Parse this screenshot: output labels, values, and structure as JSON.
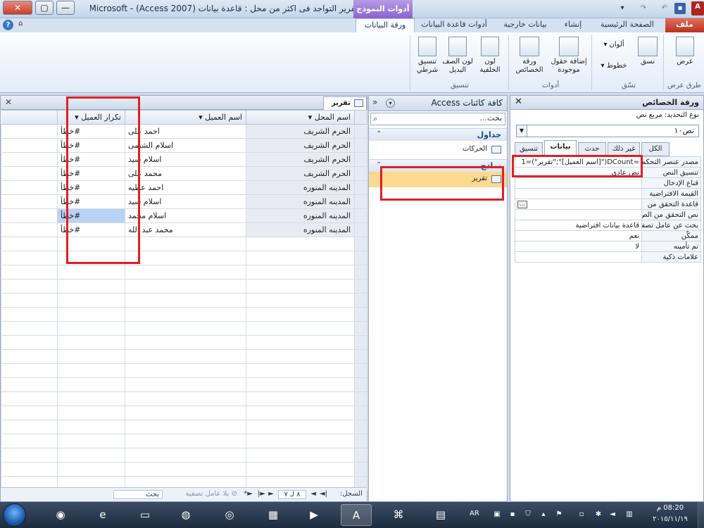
{
  "window": {
    "title": "تقرير التواجد فى اكثر من محل : قاعدة بيانات (Access 2007) - Microsoft ...",
    "context_group": "أدوات النموذج",
    "controls": {
      "close": "✕",
      "maximize": "▢",
      "minimize": "—"
    }
  },
  "ribbon_tabs": [
    {
      "label": "ملف"
    },
    {
      "label": "الصفحة الرئيسية"
    },
    {
      "label": "إنشاء"
    },
    {
      "label": "بيانات خارجية"
    },
    {
      "label": "أدوات قاعدة البيانات"
    },
    {
      "label": "ورقة البيانات"
    }
  ],
  "ribbon": {
    "view": {
      "label": "عرض",
      "group": "طرق عرض"
    },
    "format_group": {
      "label": "نسّق",
      "format_painter": "نسق",
      "font": "خطوط",
      "colors": "ألوان"
    },
    "tools_group": {
      "label": "أدوات",
      "add_fields": "إضافة حقول موجودة",
      "property_sheet": "ورقة الخصائص"
    },
    "formatting_group": {
      "label": "تنسيق",
      "background": "لون الخلفية",
      "alt_row": "لون الصف البديل",
      "conditional": "تنسيق شرطي"
    }
  },
  "datasheet": {
    "tab_label": "تقرير",
    "columns": [
      "اسم المحل",
      "اسم العميل",
      "تكرار العميل"
    ],
    "rows": [
      {
        "store": "الحرم الشريف",
        "customer": "احمد على",
        "repeat": "#خطأ"
      },
      {
        "store": "الحرم الشريف",
        "customer": "اسلام الشيمى",
        "repeat": "#خطأ"
      },
      {
        "store": "الحرم الشريف",
        "customer": "اسلام سيد",
        "repeat": "#خطأ"
      },
      {
        "store": "الحرم الشريف",
        "customer": "محمد على",
        "repeat": "#خطأ"
      },
      {
        "store": "المدينه المنوره",
        "customer": "احمد عطيه",
        "repeat": "#خطأ"
      },
      {
        "store": "المدينه المنوره",
        "customer": "اسلام سيد",
        "repeat": "#خطأ"
      },
      {
        "store": "المدينه المنوره",
        "customer": "اسلام محمد",
        "repeat": "#خطأ"
      },
      {
        "store": "المدينه المنوره",
        "customer": "محمد عبد الله",
        "repeat": "#خطأ"
      }
    ],
    "nav": {
      "record_label": "السجل:",
      "record_pos": "٨ لـ ٧",
      "no_filter": "بلا عامل تصفية",
      "search": "بحث"
    }
  },
  "nav_pane": {
    "title": "كافة كائنات Access",
    "search_placeholder": "بحث...",
    "groups": [
      {
        "label": "جداول",
        "items": [
          "الحركات"
        ]
      },
      {
        "label": "نماذج",
        "items": [
          "تقرير"
        ]
      }
    ]
  },
  "property_sheet": {
    "title": "ورقة الخصائص",
    "selection_type": "نوع التحديد: مربع نص",
    "control": "نص١٠",
    "tabs": [
      "الكل",
      "غير ذلك",
      "حدث",
      "بيانات",
      "تنسيق"
    ],
    "active_tab": "بيانات",
    "rows": [
      {
        "name": "مصدر عنصر التحكم",
        "value": "=DCount(\"[اسم العميل]\";\"تقرير\")=1"
      },
      {
        "name": "تنسيق النص",
        "value": "نص عادي"
      },
      {
        "name": "قناع الإدخال",
        "value": ""
      },
      {
        "name": "القيمة الافتراضية",
        "value": ""
      },
      {
        "name": "قاعدة التحقق من",
        "value": ""
      },
      {
        "name": "نص التحقق من الص",
        "value": ""
      },
      {
        "name": "بحث عن عامل تصفية",
        "value": "قاعدة بيانات افتراضية"
      },
      {
        "name": "ممكّن",
        "value": "نعم"
      },
      {
        "name": "تم تأمينه",
        "value": "لا"
      },
      {
        "name": "علامات ذكية",
        "value": ""
      }
    ]
  },
  "taskbar": {
    "apps": [
      "chrome-icon",
      "ie-icon",
      "explorer-icon",
      "firefox-icon",
      "opera-icon",
      "media-icon",
      "vlc-icon",
      "access-icon",
      "acrobat-icon",
      "paint-icon"
    ],
    "lang": "AR",
    "time": "08:20 م",
    "date": "٢٠١٥/١١/١٩"
  }
}
